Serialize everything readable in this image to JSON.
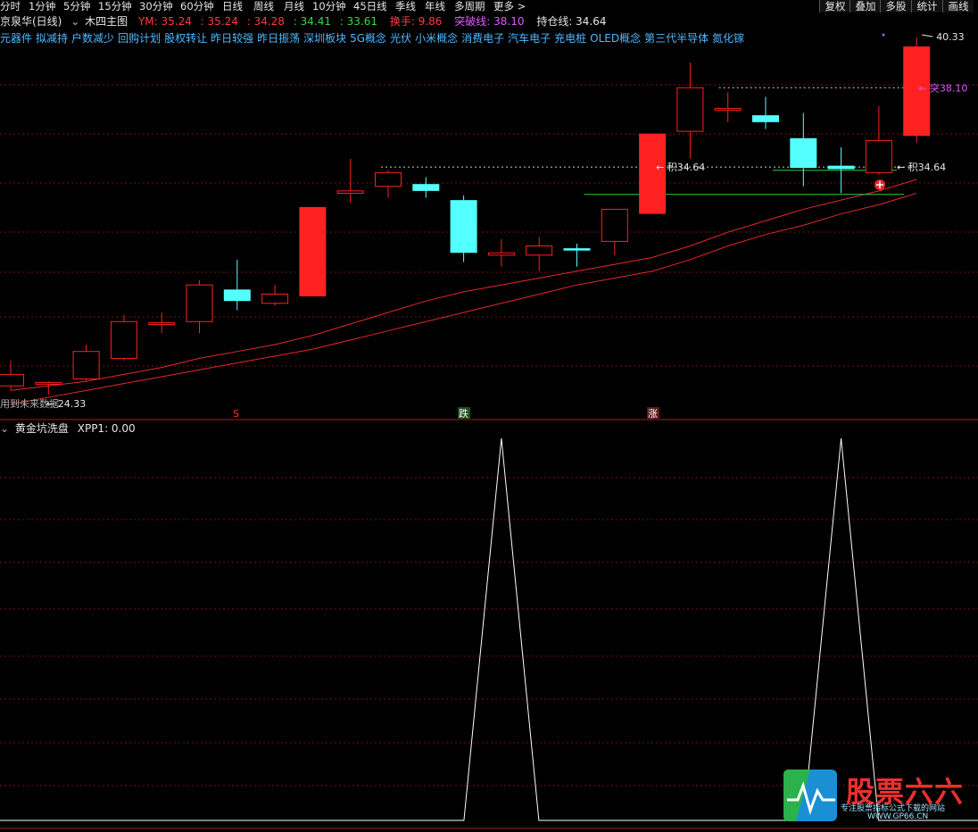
{
  "toolbar": {
    "periods": [
      "分时",
      "1分钟",
      "5分钟",
      "15分钟",
      "30分钟",
      "60分钟",
      "日线",
      "周线",
      "月线",
      "10分钟",
      "45日线",
      "季线",
      "年线",
      "多周期",
      "更多 >"
    ],
    "right_buttons": [
      "复权",
      "叠加",
      "多股",
      "统计",
      "画线"
    ]
  },
  "info": {
    "stock_name": "京泉华(日线)",
    "template_name": "木四主图",
    "ym_label": "YM: 35.24",
    "v2": ": 35.24",
    "v3": ": 34.28",
    "v4": ": 34.41",
    "v5": ": 33.61",
    "turnover": "换手: 9.86",
    "breakout": "突破线: 38.10",
    "holding": "持仓线: 34.64"
  },
  "concepts": [
    "元器件",
    "拟减持",
    "户数减少",
    "回购计划",
    "股权转让",
    "昨日较强",
    "昨日振荡",
    "深圳板块",
    "5G概念",
    "光伏",
    "小米概念",
    "消费电子",
    "汽车电子",
    "充电桩",
    "OLED概念",
    "第三代半导体",
    "氮化镓"
  ],
  "annotations": {
    "high": "40.33",
    "breakout_marker": "← 突38.10",
    "hold_marker_left": "← 积34.64",
    "hold_marker_right": "← 积34.64",
    "low_marker": "← 24.33",
    "future_hint": "用到未来数据",
    "signal_s": "S",
    "signal_fall": "跌",
    "signal_rise": "涨"
  },
  "indicator": {
    "title": "黄金坑洗盘",
    "value": "XPP1: 0.00"
  },
  "logo": {
    "text": "股票六六",
    "slogan": "专注股票指标公式下载的网站",
    "url": "WWW.GP66.CN"
  },
  "colors": {
    "up": "#ff2020",
    "down": "#54ffff",
    "ma": "#e8262a",
    "grid": "#7a1010",
    "hold_line": "#2ecc40",
    "indicator": "#ffffff"
  },
  "chart_data": {
    "type": "candlestick",
    "price_range": [
      24.33,
      40.33
    ],
    "candles": [
      {
        "o": 25.6,
        "h": 26.2,
        "l": 24.9,
        "c": 25.1,
        "dir": "up"
      },
      {
        "o": 25.2,
        "h": 25.3,
        "l": 24.7,
        "c": 25.25,
        "dir": "up"
      },
      {
        "o": 25.4,
        "h": 26.9,
        "l": 25.3,
        "c": 26.6,
        "dir": "up"
      },
      {
        "o": 26.3,
        "h": 28.2,
        "l": 26.2,
        "c": 27.9,
        "dir": "up"
      },
      {
        "o": 27.8,
        "h": 28.3,
        "l": 27.4,
        "c": 27.85,
        "dir": "up"
      },
      {
        "o": 27.9,
        "h": 29.7,
        "l": 27.4,
        "c": 29.5,
        "dir": "up"
      },
      {
        "o": 29.3,
        "h": 30.6,
        "l": 28.4,
        "c": 28.8,
        "dir": "down"
      },
      {
        "o": 28.7,
        "h": 29.5,
        "l": 28.6,
        "c": 29.1,
        "dir": "up"
      },
      {
        "o": 29.0,
        "h": 32.9,
        "l": 29.0,
        "c": 32.9,
        "dir": "up"
      },
      {
        "o": 33.5,
        "h": 35.0,
        "l": 33.1,
        "c": 33.6,
        "dir": "up"
      },
      {
        "o": 33.8,
        "h": 34.5,
        "l": 33.3,
        "c": 34.4,
        "dir": "up"
      },
      {
        "o": 33.9,
        "h": 34.2,
        "l": 33.3,
        "c": 33.6,
        "dir": "down"
      },
      {
        "o": 33.2,
        "h": 33.4,
        "l": 30.5,
        "c": 30.9,
        "dir": "down"
      },
      {
        "o": 30.8,
        "h": 31.5,
        "l": 30.3,
        "c": 30.9,
        "dir": "up"
      },
      {
        "o": 30.8,
        "h": 31.6,
        "l": 30.1,
        "c": 31.2,
        "dir": "up"
      },
      {
        "o": 31.0,
        "h": 31.3,
        "l": 30.3,
        "c": 31.1,
        "dir": "down"
      },
      {
        "o": 31.4,
        "h": 32.8,
        "l": 30.8,
        "c": 32.8,
        "dir": "up"
      },
      {
        "o": 32.6,
        "h": 36.1,
        "l": 32.6,
        "c": 36.1,
        "dir": "up"
      },
      {
        "o": 36.2,
        "h": 39.2,
        "l": 35.0,
        "c": 38.1,
        "dir": "up"
      },
      {
        "o": 37.2,
        "h": 37.9,
        "l": 36.6,
        "c": 37.2,
        "dir": "up"
      },
      {
        "o": 36.9,
        "h": 37.7,
        "l": 36.3,
        "c": 36.6,
        "dir": "down"
      },
      {
        "o": 35.9,
        "h": 37.0,
        "l": 33.8,
        "c": 34.6,
        "dir": "down"
      },
      {
        "o": 34.7,
        "h": 35.5,
        "l": 33.5,
        "c": 34.55,
        "dir": "down"
      },
      {
        "o": 34.4,
        "h": 37.3,
        "l": 34.3,
        "c": 35.8,
        "dir": "up"
      },
      {
        "o": 36.0,
        "h": 40.3,
        "l": 35.7,
        "c": 39.9,
        "dir": "up"
      }
    ],
    "ma_fast": [
      24.9,
      25.1,
      25.3,
      25.6,
      25.9,
      26.3,
      26.6,
      26.9,
      27.3,
      27.8,
      28.3,
      28.8,
      29.2,
      29.5,
      29.8,
      30.1,
      30.4,
      30.7,
      31.2,
      31.8,
      32.3,
      32.8,
      33.2,
      33.6,
      34.1
    ],
    "ma_slow": [
      24.3,
      24.6,
      24.9,
      25.2,
      25.5,
      25.8,
      26.1,
      26.4,
      26.7,
      27.1,
      27.5,
      27.9,
      28.3,
      28.7,
      29.1,
      29.5,
      29.8,
      30.1,
      30.6,
      31.2,
      31.7,
      32.1,
      32.6,
      33.0,
      33.5
    ],
    "breakout_line": 38.1,
    "hold_line": 34.64,
    "indicator_series": {
      "name": "XPP1",
      "peaks_at_candle": [
        13,
        22
      ],
      "value_range": [
        0,
        1
      ]
    }
  }
}
